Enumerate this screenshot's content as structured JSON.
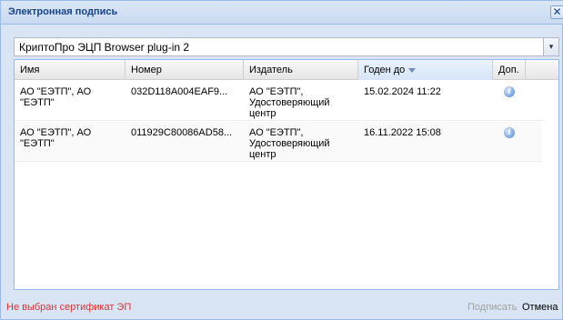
{
  "window": {
    "title": "Электронная подпись",
    "close_icon": "✕"
  },
  "plugin_select": {
    "value": "КриптоПро ЭЦП Browser plug-in 2",
    "trigger_icon": "▾"
  },
  "grid": {
    "columns": [
      {
        "label": "Имя"
      },
      {
        "label": "Номер"
      },
      {
        "label": "Издатель"
      },
      {
        "label": "Годен до",
        "sorted": "desc"
      },
      {
        "label": "Доп."
      }
    ],
    "rows": [
      {
        "name": "АО \"ЕЭТП\", АО \"ЕЭТП\"",
        "number": "032D118A004EAF9...",
        "issuer": "АО \"ЕЭТП\", Удостоверяющий центр",
        "valid_until": "15.02.2024 11:22",
        "extra_icon": "info-icon"
      },
      {
        "name": "АО \"ЕЭТП\", АО \"ЕЭТП\"",
        "number": "011929C80086AD58...",
        "issuer": "АО \"ЕЭТП\", Удостоверяющий центр",
        "valid_until": "16.11.2022 15:08",
        "extra_icon": "info-icon"
      }
    ]
  },
  "footer": {
    "status": "Не выбран сертификат ЭП",
    "status_color": "#e03030",
    "sign_label": "Подписать",
    "cancel_label": "Отмена"
  }
}
